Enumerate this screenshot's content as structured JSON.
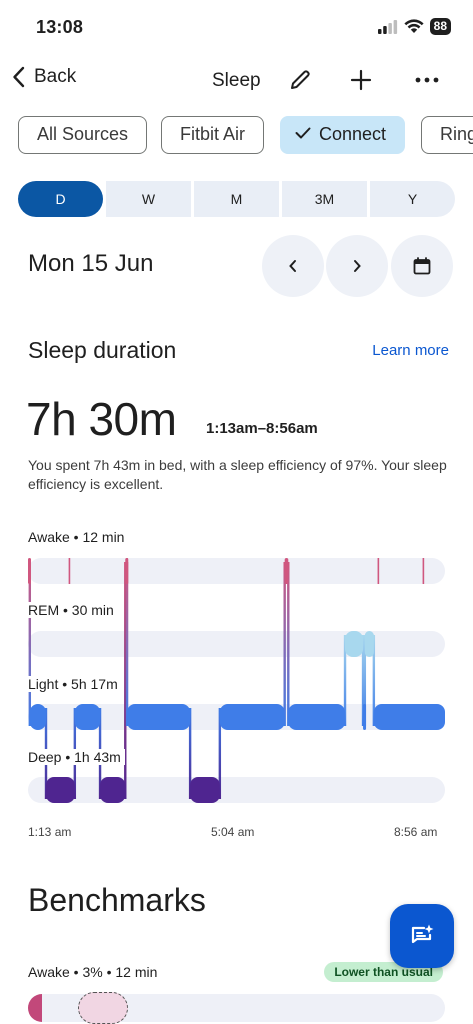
{
  "status_bar": {
    "time": "13:08",
    "battery": "88"
  },
  "nav": {
    "back_label": "Back",
    "title": "Sleep"
  },
  "sources": [
    "All Sources",
    "Fitbit Air",
    "Connect",
    "Ring"
  ],
  "selected_source": "Connect",
  "periods": [
    "D",
    "W",
    "M",
    "3M",
    "Y"
  ],
  "active_period": "D",
  "date": "Mon 15 Jun",
  "sleep": {
    "section_title": "Sleep duration",
    "learn_more": "Learn more",
    "duration": "7h 30m",
    "range": "1:13am–8:56am",
    "description": "You spent 7h 43m in bed, with a sleep efficiency of 97%. Your sleep efficiency is excellent."
  },
  "chart_data": {
    "type": "hypnogram",
    "stages": [
      {
        "name": "Awake",
        "duration": "12 min",
        "label": "Awake • 12 min",
        "color": "#d0577f"
      },
      {
        "name": "REM",
        "duration": "30 min",
        "label": "REM • 30 min",
        "color": "#a8d8ee"
      },
      {
        "name": "Light",
        "duration": "5h 17m",
        "label": "Light • 5h 17m",
        "color": "#3f7de8"
      },
      {
        "name": "Deep",
        "duration": "1h 43m",
        "label": "Deep • 1h 43m",
        "color": "#4f2590"
      }
    ],
    "x_ticks": [
      "1:13 am",
      "5:04 am",
      "8:56 am"
    ],
    "x_range_minutes": [
      0,
      463
    ],
    "segments": [
      {
        "stage": "Awake",
        "start": 0,
        "end": 2
      },
      {
        "stage": "Light",
        "start": 2,
        "end": 20
      },
      {
        "stage": "Deep",
        "start": 20,
        "end": 52
      },
      {
        "stage": "Light",
        "start": 52,
        "end": 80
      },
      {
        "stage": "Deep",
        "start": 80,
        "end": 108
      },
      {
        "stage": "Awake",
        "start": 108,
        "end": 110
      },
      {
        "stage": "Light",
        "start": 110,
        "end": 180
      },
      {
        "stage": "Deep",
        "start": 180,
        "end": 213
      },
      {
        "stage": "Light",
        "start": 213,
        "end": 285
      },
      {
        "stage": "Awake",
        "start": 285,
        "end": 289
      },
      {
        "stage": "Light",
        "start": 289,
        "end": 352
      },
      {
        "stage": "REM",
        "start": 352,
        "end": 372
      },
      {
        "stage": "Light",
        "start": 372,
        "end": 374
      },
      {
        "stage": "REM",
        "start": 374,
        "end": 384
      },
      {
        "stage": "Light",
        "start": 384,
        "end": 463
      }
    ],
    "awake_ticks": [
      46,
      110,
      389,
      439
    ]
  },
  "benchmarks": {
    "title": "Benchmarks",
    "awake_label": "Awake • 3% • 12 min",
    "badge": "Lower than usual",
    "awake_percent": 3
  }
}
